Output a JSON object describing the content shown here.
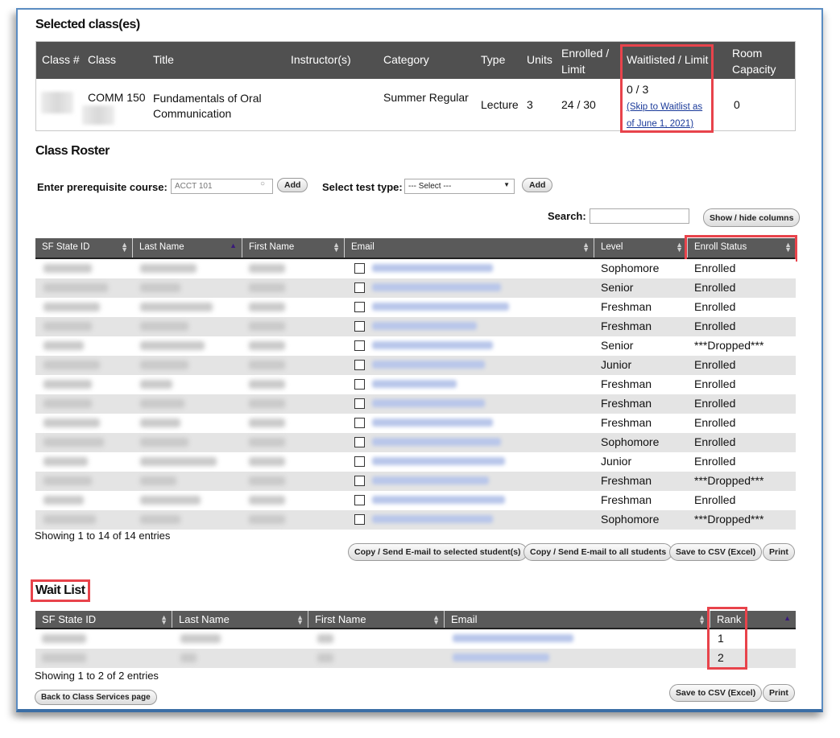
{
  "selected_classes": {
    "heading": "Selected class(es)",
    "columns": [
      "Class #",
      "Class",
      "Title",
      "Instructor(s)",
      "Category",
      "Type",
      "Units",
      "Enrolled / Limit",
      "Waitlisted / Limit",
      "Room Capacity"
    ],
    "row": {
      "class": "COMM 150",
      "title": "Fundamentals of Oral Communication",
      "instructor": "",
      "category": "Summer Regular",
      "type": "Lecture",
      "units": "3",
      "enrolled_limit": "24 / 30",
      "waitlisted_limit": "0 / 3",
      "waitlist_link": "(Skip to Waitlist as of June 1, 2021)",
      "room_capacity": "0"
    }
  },
  "roster": {
    "heading": "Class Roster",
    "prereq_label": "Enter prerequisite course:",
    "prereq_placeholder": "ACCT 101",
    "add_label": "Add",
    "test_type_label": "Select test type:",
    "test_type_selected": "--- Select ---",
    "search_label": "Search:",
    "search_value": "",
    "show_hide_label": "Show / hide columns",
    "columns": [
      "SF State ID",
      "Last Name",
      "First Name",
      "Email",
      "Level",
      "Enroll Status"
    ],
    "rows": [
      {
        "level": "Sophomore",
        "status": "Enrolled"
      },
      {
        "level": "Senior",
        "status": "Enrolled"
      },
      {
        "level": "Freshman",
        "status": "Enrolled"
      },
      {
        "level": "Freshman",
        "status": "Enrolled"
      },
      {
        "level": "Senior",
        "status": "***Dropped***"
      },
      {
        "level": "Junior",
        "status": "Enrolled"
      },
      {
        "level": "Freshman",
        "status": "Enrolled"
      },
      {
        "level": "Freshman",
        "status": "Enrolled"
      },
      {
        "level": "Freshman",
        "status": "Enrolled"
      },
      {
        "level": "Sophomore",
        "status": "Enrolled"
      },
      {
        "level": "Junior",
        "status": "Enrolled"
      },
      {
        "level": "Freshman",
        "status": "***Dropped***"
      },
      {
        "level": "Freshman",
        "status": "Enrolled"
      },
      {
        "level": "Sophomore",
        "status": "***Dropped***"
      }
    ],
    "info": "Showing 1 to 14 of 14 entries",
    "buttons": [
      "Copy / Send E-mail to selected student(s)",
      "Copy / Send E-mail to all students",
      "Save to CSV (Excel)",
      "Print"
    ]
  },
  "waitlist": {
    "heading": "Wait List",
    "columns": [
      "SF State ID",
      "Last Name",
      "First Name",
      "Email",
      "Rank"
    ],
    "rows": [
      {
        "rank": "1"
      },
      {
        "rank": "2"
      }
    ],
    "info": "Showing 1 to 2 of 2 entries",
    "back_label": "Back to Class Services page",
    "buttons": [
      "Save to CSV (Excel)",
      "Print"
    ]
  }
}
